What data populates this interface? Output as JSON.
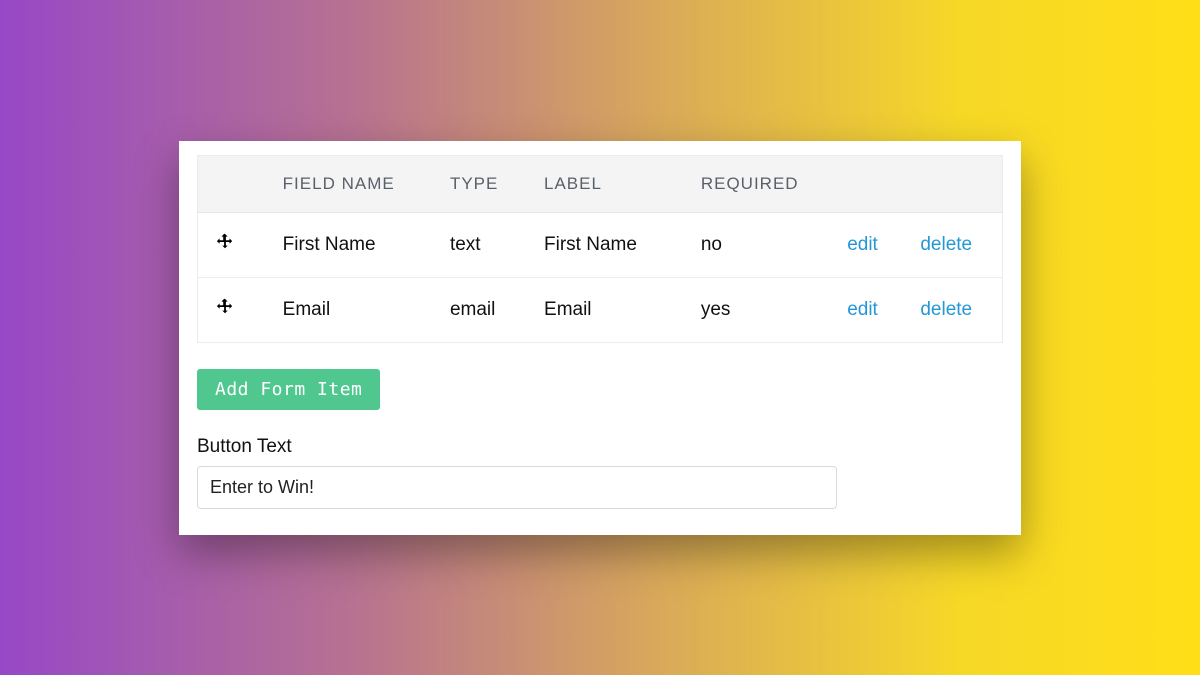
{
  "table": {
    "headers": {
      "drag": "",
      "field_name": "FIELD NAME",
      "type": "TYPE",
      "label": "LABEL",
      "required": "REQUIRED",
      "edit": "",
      "delete": ""
    },
    "rows": [
      {
        "field_name": "First Name",
        "type": "text",
        "label": "First Name",
        "required": "no"
      },
      {
        "field_name": "Email",
        "type": "email",
        "label": "Email",
        "required": "yes"
      }
    ],
    "actions": {
      "edit": "edit",
      "delete": "delete"
    }
  },
  "add_button_label": "Add Form Item",
  "button_text": {
    "label": "Button Text",
    "value": "Enter to Win!"
  },
  "icons": {
    "drag": "move-icon"
  }
}
